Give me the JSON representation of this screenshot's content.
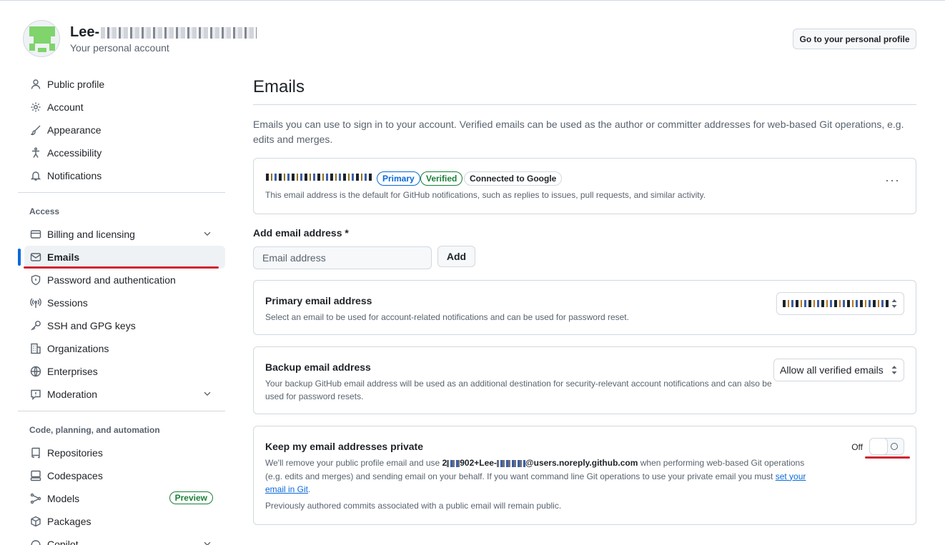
{
  "header": {
    "account_name": "Lee-",
    "account_sub": "Your personal account",
    "profile_button": "Go to your personal profile"
  },
  "sidebar": {
    "items_top": [
      {
        "label": "Public profile",
        "icon": "person-icon"
      },
      {
        "label": "Account",
        "icon": "gear-icon"
      },
      {
        "label": "Appearance",
        "icon": "paintbrush-icon"
      },
      {
        "label": "Accessibility",
        "icon": "accessibility-icon"
      },
      {
        "label": "Notifications",
        "icon": "bell-icon"
      }
    ],
    "access_heading": "Access",
    "items_access": [
      {
        "label": "Billing and licensing",
        "icon": "credit-card-icon"
      },
      {
        "label": "Emails",
        "icon": "mail-icon"
      },
      {
        "label": "Password and authentication",
        "icon": "shield-icon"
      },
      {
        "label": "Sessions",
        "icon": "broadcast-icon"
      },
      {
        "label": "SSH and GPG keys",
        "icon": "key-icon"
      },
      {
        "label": "Organizations",
        "icon": "organization-icon"
      },
      {
        "label": "Enterprises",
        "icon": "globe-icon"
      },
      {
        "label": "Moderation",
        "icon": "report-icon"
      }
    ],
    "code_heading": "Code, planning, and automation",
    "items_code": [
      {
        "label": "Repositories",
        "icon": "repo-icon"
      },
      {
        "label": "Codespaces",
        "icon": "codespaces-icon"
      },
      {
        "label": "Models",
        "icon": "models-icon",
        "badge": "Preview"
      },
      {
        "label": "Packages",
        "icon": "package-icon"
      },
      {
        "label": "Copilot",
        "icon": "copilot-icon"
      }
    ]
  },
  "main": {
    "title": "Emails",
    "intro": "Emails you can use to sign in to your account. Verified emails can be used as the author or committer addresses for web-based Git operations, e.g. edits and merges.",
    "email_card": {
      "labels": [
        "Primary",
        "Verified",
        "Connected to Google"
      ],
      "description": "This email address is the default for GitHub notifications, such as replies to issues, pull requests, and similar activity."
    },
    "add_email": {
      "label": "Add email address *",
      "placeholder": "Email address",
      "button": "Add"
    },
    "primary_email": {
      "title": "Primary email address",
      "description": "Select an email to be used for account-related notifications and can be used for password reset."
    },
    "backup_email": {
      "title": "Backup email address",
      "description": "Your backup GitHub email address will be used as an additional destination for security-relevant account notifications and can also be used for password resets.",
      "selected": "Allow all verified emails"
    },
    "private_email": {
      "title": "Keep my email addresses private",
      "desc_1": "We'll remove your public profile email and use ",
      "addr_a": "2",
      "addr_b": "902+Lee-",
      "addr_c": "@users.noreply.github.com",
      "desc_2": " when performing web-based Git operations (e.g. edits and merges) and sending email on your behalf. If you want command line Git operations to use your private email you must ",
      "link": "set your email in Git",
      "desc_3": ".",
      "note": "Previously authored commits associated with a public email will remain public.",
      "toggle_label": "Off",
      "enabled": false
    }
  },
  "colors": {
    "accent": "#0969da",
    "success": "#1a7f37",
    "annotation_red": "#d1242f"
  }
}
